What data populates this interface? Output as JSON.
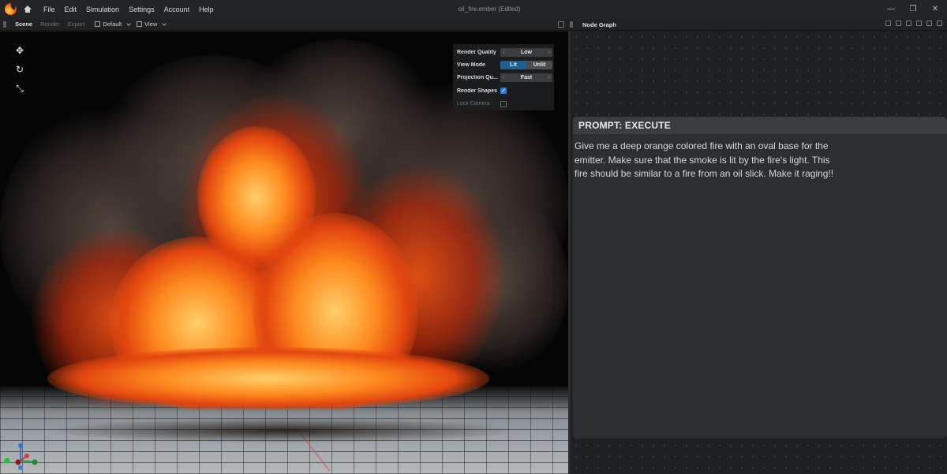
{
  "menu": [
    "File",
    "Edit",
    "Simulation",
    "Settings",
    "Account",
    "Help"
  ],
  "document_title": "oil_fire.ember",
  "document_status": "(Edited)",
  "window_controls": {
    "minimize": "—",
    "maximize": "❐",
    "close": "✕"
  },
  "toolbar": {
    "tabs": [
      "Scene",
      "Render",
      "Export"
    ],
    "active_tab": "Scene",
    "preset": "Default",
    "view": "View"
  },
  "node_graph": {
    "title": "Node Graph"
  },
  "render_settings": {
    "quality_label": "Render Quality",
    "quality_value": "Low",
    "view_mode_label": "View Mode",
    "view_mode_options": [
      "Lit",
      "Unlit"
    ],
    "view_mode_selected": "Lit",
    "projection_label": "Projection Qu...",
    "projection_value": "Fast",
    "render_shapes_label": "Render Shapes",
    "render_shapes_checked": true,
    "lock_camera_label": "Lock Camera",
    "lock_camera_checked": false
  },
  "prompt": {
    "header": "PROMPT: EXECUTE",
    "text": "Give me a deep orange colored fire with an oval base for the emitter. Make sure that the smoke is lit by the fire's light. This fire should be similar to a fire from an oil slick. Make it raging!!"
  },
  "colors": {
    "accent_blue": "#1e5f8f",
    "checkbox_blue": "#2a7fd4",
    "fire_orange": "#ff8a1e"
  },
  "icons": [
    "app-logo",
    "home-icon",
    "move-tool-icon",
    "rotate-tool-icon",
    "scale-tool-icon",
    "axis-gizmo-icon"
  ]
}
